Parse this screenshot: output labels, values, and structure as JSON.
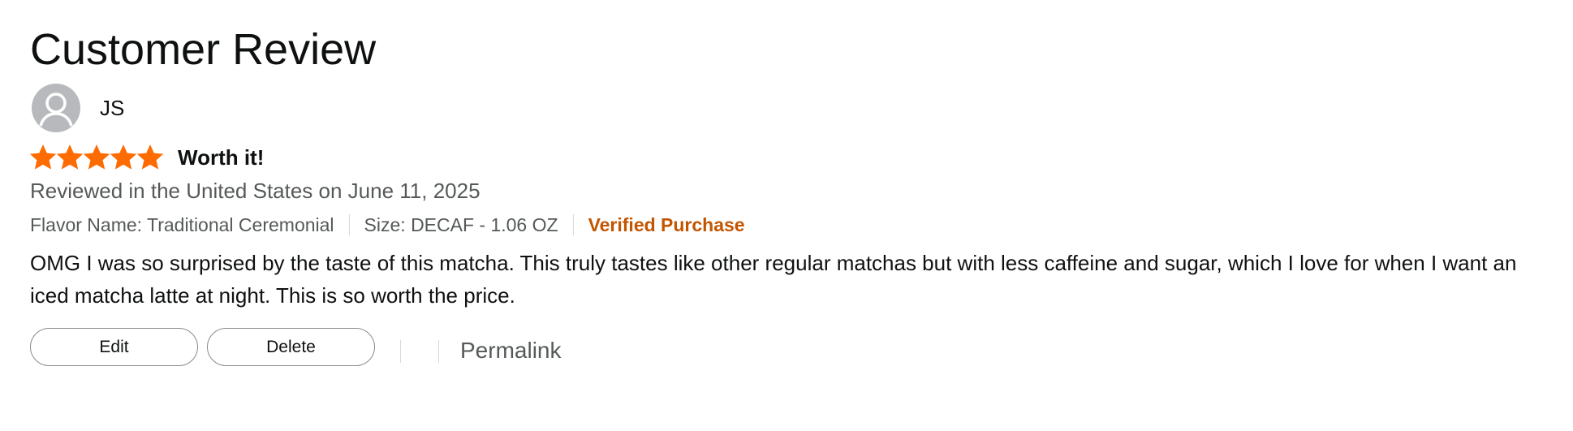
{
  "page": {
    "title": "Customer Review"
  },
  "reviewer": {
    "name": "JS",
    "avatar_icon": "default-user-avatar-icon"
  },
  "review": {
    "rating": 5,
    "rating_max": 5,
    "star_color": "#fe6b00",
    "title": "Worth it!",
    "date_line": "Reviewed in the United States on June 11, 2025",
    "flavor": "Flavor Name: Traditional Ceremonial",
    "size": "Size: DECAF - 1.06 OZ",
    "verified_label": "Verified Purchase",
    "verified_color": "#c45500",
    "body": "OMG I was so surprised by the taste of this matcha. This truly tastes like other regular matchas but with less caffeine and sugar, which I love for when I want an iced matcha latte at night. This is so worth the price."
  },
  "actions": {
    "edit_label": "Edit",
    "delete_label": "Delete",
    "permalink_label": "Permalink"
  }
}
